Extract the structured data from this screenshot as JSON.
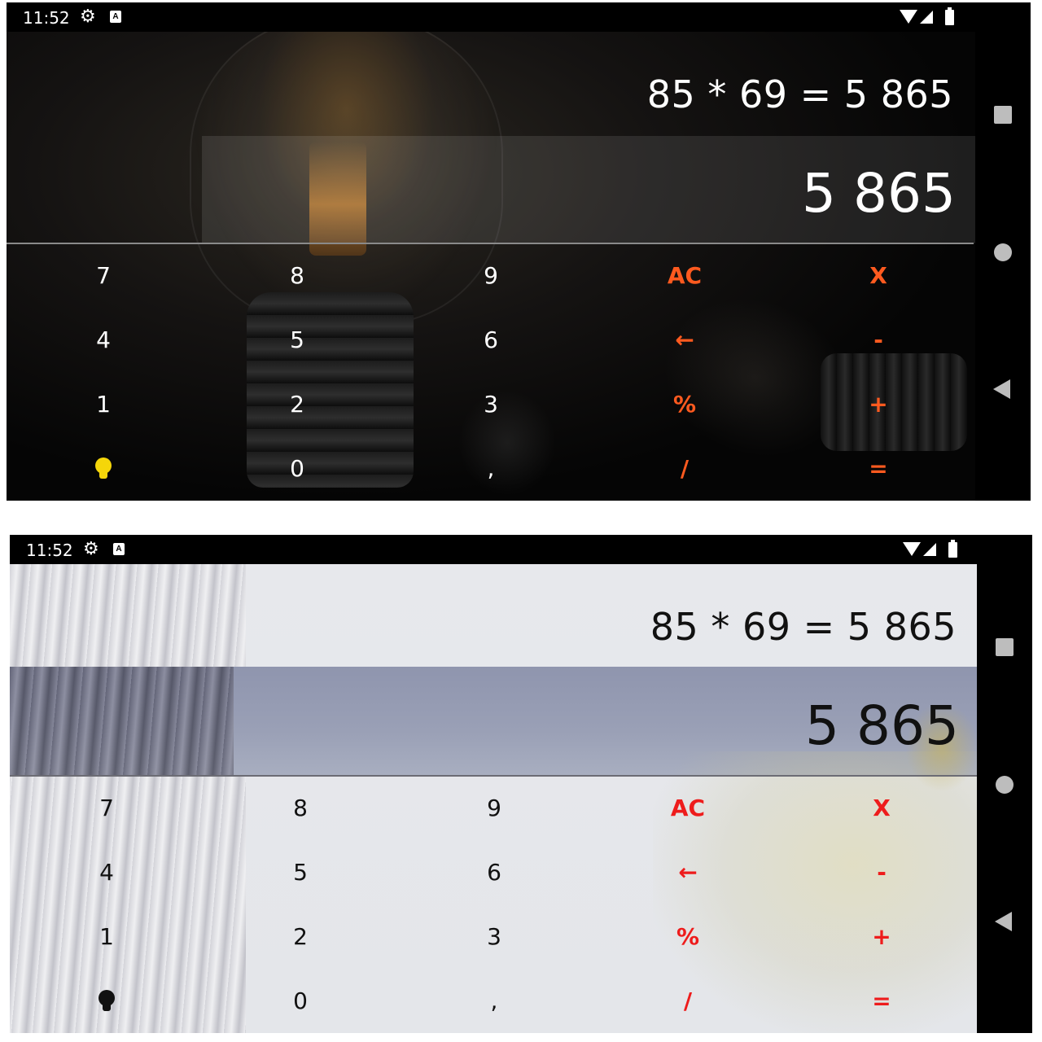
{
  "status_bar": {
    "time": "11:52",
    "icons": [
      "settings-gear-icon",
      "keyboard-a-icon",
      "wifi-icon",
      "signal-icon",
      "battery-icon"
    ]
  },
  "nav_bar": {
    "icons": [
      "recents-square-icon",
      "home-circle-icon",
      "back-triangle-icon"
    ]
  },
  "display": {
    "expression": "85 * 69 = 5 865",
    "result": "5 865"
  },
  "keypad": {
    "rows": [
      [
        "7",
        "8",
        "9",
        "AC",
        "X"
      ],
      [
        "4",
        "5",
        "6",
        "←",
        "-"
      ],
      [
        "1",
        "2",
        "3",
        "%",
        "+"
      ],
      [
        "bulb-icon",
        "0",
        ",",
        "/",
        "="
      ]
    ]
  },
  "themes": {
    "dark": {
      "text_color": "#ffffff",
      "operator_color": "#ff5a1f",
      "bulb_icon_color": "#f5d60a"
    },
    "light": {
      "text_color": "#111111",
      "operator_color": "#ee1c1c",
      "bulb_icon_color": "#111111"
    }
  }
}
